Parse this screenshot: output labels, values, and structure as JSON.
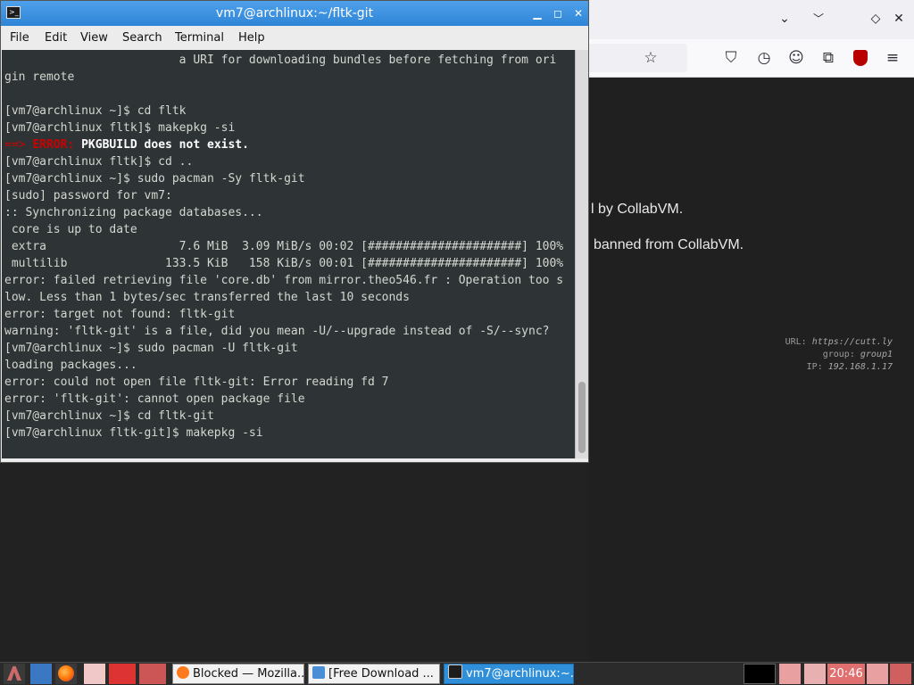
{
  "terminal": {
    "title": "vm7@archlinux:~/fltk-git",
    "menu": [
      "File",
      "Edit",
      "View",
      "Search",
      "Terminal",
      "Help"
    ],
    "lines": [
      {
        "text": "                         a URI for downloading bundles before fetching from ori"
      },
      {
        "text": "gin remote"
      },
      {
        "text": ""
      },
      {
        "text": "[vm7@archlinux ~]$ cd fltk"
      },
      {
        "text": "[vm7@archlinux fltk]$ makepkg -si"
      },
      {
        "arrow": "==> ",
        "label": "ERROR:",
        "bold": " PKGBUILD does not exist."
      },
      {
        "text": "[vm7@archlinux fltk]$ cd .."
      },
      {
        "text": "[vm7@archlinux ~]$ sudo pacman -Sy fltk-git"
      },
      {
        "text": "[sudo] password for vm7:"
      },
      {
        "text": ":: Synchronizing package databases..."
      },
      {
        "text": " core is up to date"
      },
      {
        "text": " extra                   7.6 MiB  3.09 MiB/s 00:02 [######################] 100%"
      },
      {
        "text": " multilib              133.5 KiB   158 KiB/s 00:01 [######################] 100%"
      },
      {
        "text": "error: failed retrieving file 'core.db' from mirror.theo546.fr : Operation too s"
      },
      {
        "text": "low. Less than 1 bytes/sec transferred the last 10 seconds"
      },
      {
        "text": "error: target not found: fltk-git"
      },
      {
        "text": "warning: 'fltk-git' is a file, did you mean -U/--upgrade instead of -S/--sync?"
      },
      {
        "text": "[vm7@archlinux ~]$ sudo pacman -U fltk-git"
      },
      {
        "text": "loading packages..."
      },
      {
        "text": "error: could not open file fltk-git: Error reading fd 7"
      },
      {
        "text": "error: 'fltk-git': cannot open package file"
      },
      {
        "text": "[vm7@archlinux ~]$ cd fltk-git"
      },
      {
        "text": "[vm7@archlinux fltk-git]$ makepkg -si"
      }
    ]
  },
  "browser": {
    "page_lines": [
      "l by CollabVM.",
      "banned from CollabVM."
    ],
    "watermark": {
      "url_label": "URL:",
      "url_value": "https://cutt.ly",
      "group_label": "group:",
      "group_value": "group1",
      "ip_label": "IP:",
      "ip_value": "192.168.1.17"
    }
  },
  "taskbar": {
    "tasks": [
      {
        "label": "Blocked — Mozilla..."
      },
      {
        "label": "[Free Download ..."
      },
      {
        "label": "vm7@archlinux:~..."
      }
    ],
    "clock": "20:46"
  },
  "colors": {
    "terminal_bg": "#2e3436",
    "title_accent": "#3b8fe0",
    "error_red": "#cc0000"
  }
}
